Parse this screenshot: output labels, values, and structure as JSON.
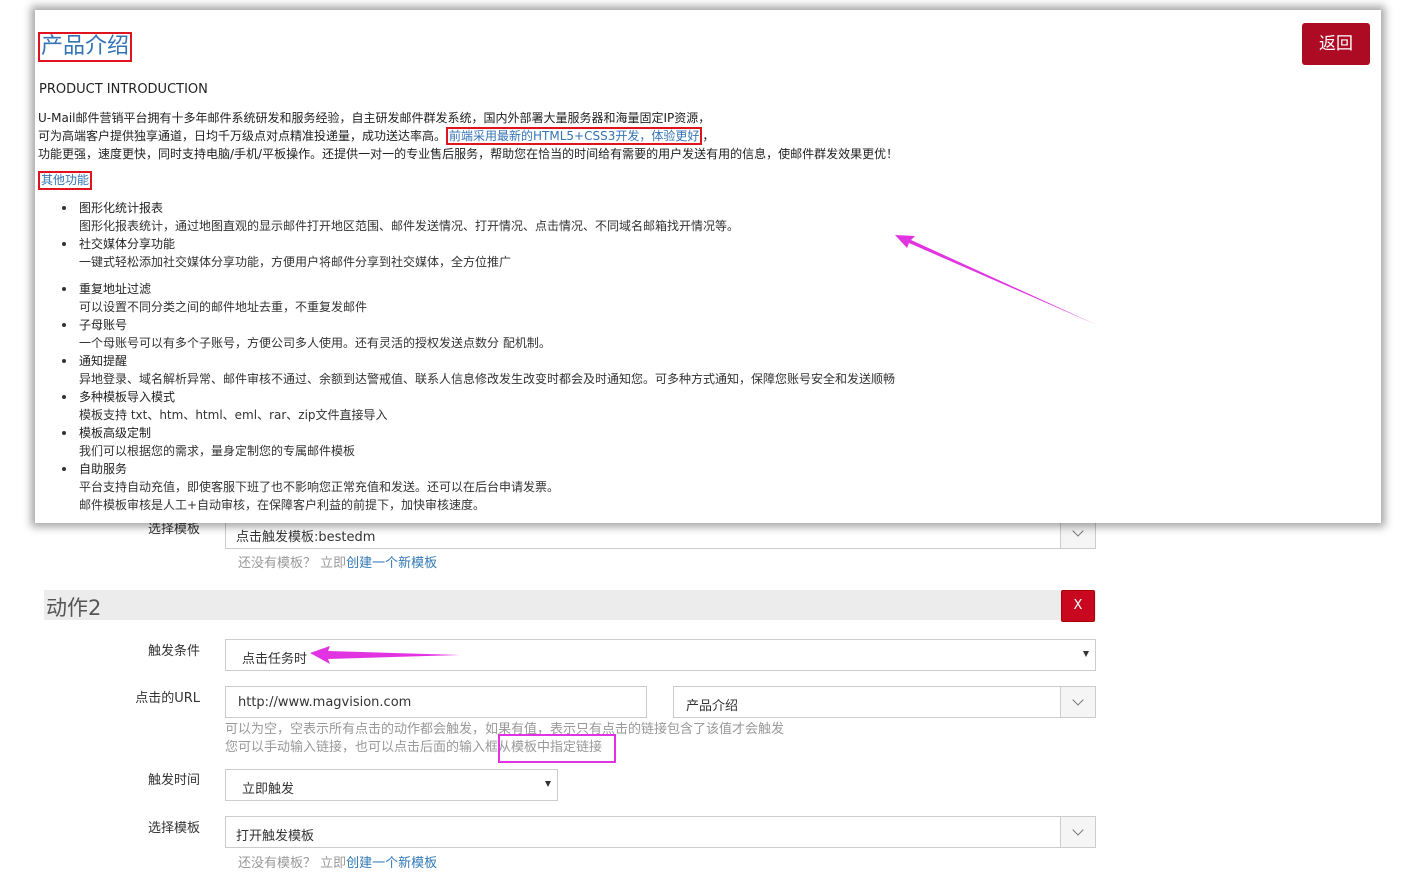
{
  "background_form": {
    "action1": {
      "template_label": "选择模板",
      "template_value": "点击触发模板:bestedm",
      "no_template_hint": "还没有模板？ 立即",
      "create_link": "创建一个新模板"
    },
    "action2": {
      "section_title": "动作2",
      "delete_button": "X",
      "trigger_label": "触发条件",
      "trigger_value": "点击任务时",
      "url_label": "点击的URL",
      "url_value": "http://www.magvision.com",
      "url_picker_value": "产品介绍",
      "url_hint_1": "可以为空，空表示所有点击的动作都会触发，如果有值，表示只有点击的链接包含了该值才会触发",
      "url_hint_2": "您可以手动输入链接，也可以点击后面的输入框从模板中指定链接",
      "time_label": "触发时间",
      "time_value": "立即触发",
      "template_label": "选择模板",
      "template_value": "打开触发模板",
      "no_template_hint": "还没有模板？ 立即",
      "create_link": "创建一个新模板"
    }
  },
  "modal": {
    "title": "产品介绍",
    "back_button": "返回",
    "en_heading": "PRODUCT INTRODUCTION",
    "intro_line1": "U-Mail邮件营销平台拥有十多年邮件系统研发和服务经验，自主研发邮件群发系统，国内外部署大量服务器和海量固定IP资源，",
    "intro_line2_a": "可为高端客户提供独享通道，日均千万级点对点精准投递量，成功送达率高。",
    "intro_line2_link": "前端采用最新的HTML5+CSS3开发，体验更好",
    "intro_line2_b": "，",
    "intro_line3": "功能更强，速度更快，同时支持电脑/手机/平板操作。还提供一对一的专业售后服务，帮助您在恰当的时间给有需要的用户发送有用的信息，使邮件群发效果更优！",
    "other_heading": "其他功能",
    "features": [
      {
        "title": "图形化统计报表",
        "desc": "图形化报表统计，通过地图直观的显示邮件打开地区范围、邮件发送情况、打开情况、点击情况、不同域名邮箱找开情况等。"
      },
      {
        "title": "社交媒体分享功能",
        "desc": "一键式轻松添加社交媒体分享功能，方便用户将邮件分享到社交媒体，全方位推广"
      },
      {
        "title": "重复地址过滤",
        "desc": "可以设置不同分类之间的邮件地址去重，不重复发邮件"
      },
      {
        "title": "子母账号",
        "desc": "一个母账号可以有多个子账号，方便公司多人使用。还有灵活的授权发送点数分 配机制。"
      },
      {
        "title": "通知提醒",
        "desc": "异地登录、域名解析异常、邮件审核不通过、余额到达警戒值、联系人信息修改发生改变时都会及时通知您。可多种方式通知，保障您账号安全和发送顺畅"
      },
      {
        "title": "多种模板导入模式",
        "desc": "模板支持 txt、htm、html、eml、rar、zip文件直接导入"
      },
      {
        "title": "模板高级定制",
        "desc": "我们可以根据您的需求，量身定制您的专属邮件模板"
      },
      {
        "title": "自助服务",
        "desc": "平台支持自动充值，即使客服下班了也不影响您正常充值和发送。还可以在后台申请发票。",
        "desc2": "邮件模板审核是人工+自动审核，在保障客户利益的前提下，加快审核速度。"
      }
    ]
  },
  "colors": {
    "accent": "#ad0b24",
    "link": "#3474b4",
    "annotation": "#e233e2",
    "highlight_box": "#e0141e"
  }
}
